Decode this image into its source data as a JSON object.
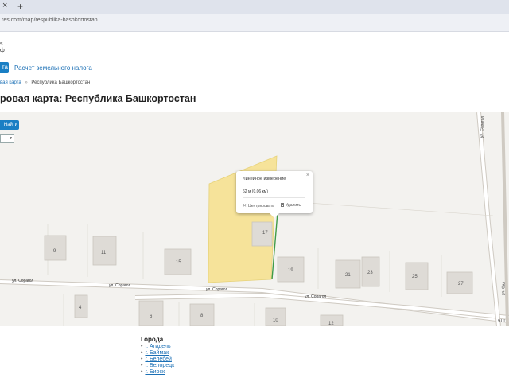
{
  "browser": {
    "tab_close_glyph": "×",
    "new_tab_glyph": "+",
    "url": "res.com/map/respublika-bashkortostan"
  },
  "header": {
    "logo_fragment_1": "s",
    "logo_fragment_2": "ф",
    "nav_active_fragment": "та",
    "nav_link": "Расчет земельного налога"
  },
  "breadcrumbs": {
    "parent": "вая карта",
    "separator": "»",
    "current": "Республика Башкортостан"
  },
  "page_title": "ровая карта: Республика Башкортостан",
  "map": {
    "find_button": "Найти",
    "layer_select_arrow": "▾",
    "popup": {
      "title": "Линейное измерение",
      "close_glyph": "×",
      "value": "62 м (0.06 км)",
      "center_action": "Центрировать",
      "delete_action": "Удалить"
    },
    "house_numbers": [
      "9",
      "11",
      "15",
      "17",
      "19",
      "21",
      "23",
      "25",
      "27",
      "4",
      "6",
      "8",
      "10",
      "12"
    ],
    "streets": {
      "sorgal_1": "ул. Сорагол",
      "sorgal_2": "ул. Сорагол",
      "sorgal_3": "ул. Сорагол",
      "sorgal_4": "ул. Сорагол",
      "vertical_right": "ул. Сорагол",
      "vertical_far_right": "ул. Сал",
      "corner_fragment": "9 Ш"
    },
    "colors": {
      "parcel_fill": "#f6e39a",
      "measure_line": "#3f9b48",
      "building_fill": "#dedbd6"
    }
  },
  "cities": {
    "title": "Города",
    "items": [
      "г. Агидель",
      "г. Баймак",
      "г. Белебей",
      "г. Белорецк",
      "г. Бирск"
    ]
  }
}
